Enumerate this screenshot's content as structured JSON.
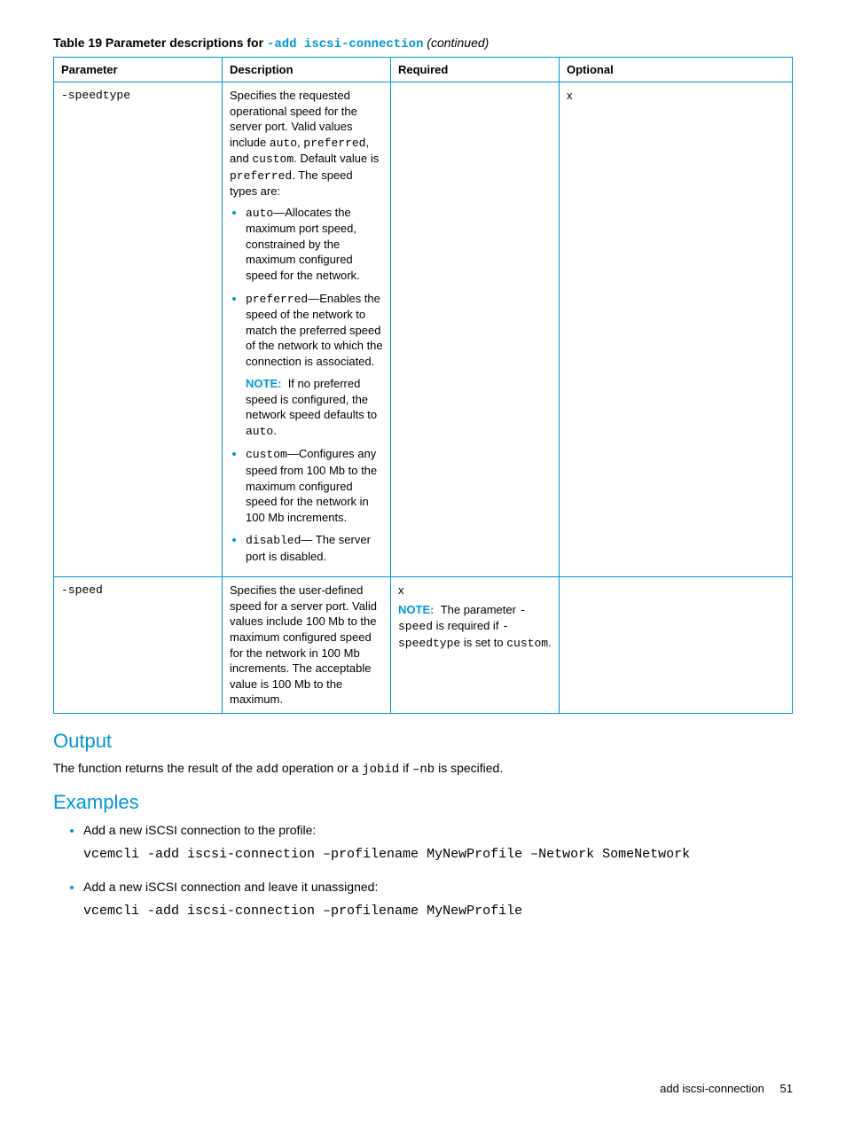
{
  "table": {
    "title_prefix": "Table 19 Parameter descriptions for ",
    "title_code": "-add iscsi-connection",
    "title_suffix": " (continued)",
    "headers": {
      "param": "Parameter",
      "desc": "Description",
      "req": "Required",
      "opt": "Optional"
    },
    "row1": {
      "param": "-speedtype",
      "desc_intro_a": "Specifies the requested operational speed for the server port. Valid values include ",
      "desc_intro_b": "auto",
      "desc_intro_c": ", ",
      "desc_intro_d": "preferred",
      "desc_intro_e": ", and ",
      "desc_intro_f": "custom",
      "desc_intro_g": ". Default value is ",
      "desc_intro_h": "preferred",
      "desc_intro_i": ". The speed types are:",
      "li1_a": "auto",
      "li1_b": "—Allocates the maximum port speed, constrained by the maximum configured speed for the network.",
      "li2_a": "preferred",
      "li2_b": "—Enables the speed of the network to match the preferred speed of the network to which the connection is associated.",
      "note_label": "NOTE:",
      "note_text_a": "If no preferred speed is configured, the network speed defaults to ",
      "note_text_b": "auto",
      "note_text_c": ".",
      "li3_a": "custom",
      "li3_b": "—Configures any speed from 100 Mb to the maximum configured speed for the network in 100 Mb increments.",
      "li4_a": "disabled",
      "li4_b": "— The server port is disabled.",
      "req": "",
      "opt": "x"
    },
    "row2": {
      "param": "-speed",
      "desc": "Specifies the user-defined speed for a server port. Valid values include 100 Mb to the maximum configured speed for the network in 100 Mb increments. The acceptable value is 100 Mb to the maximum.",
      "req_x": "x",
      "note_label": "NOTE:",
      "req_note_a": "The parameter ",
      "req_note_b": "-speed",
      "req_note_c": " is required if ",
      "req_note_d": "-speedtype",
      "req_note_e": " is set to ",
      "req_note_f": "custom",
      "req_note_g": ".",
      "opt": ""
    }
  },
  "output": {
    "heading": "Output",
    "text_a": "The function returns the result of the ",
    "text_b": "add",
    "text_c": " operation or a ",
    "text_d": "jobid",
    "text_e": " if ",
    "text_f": "–nb",
    "text_g": " is specified."
  },
  "examples": {
    "heading": "Examples",
    "item1_text": "Add a new iSCSI connection to the profile:",
    "item1_code": "vcemcli -add iscsi-connection –profilename MyNewProfile –Network SomeNetwork",
    "item2_text": "Add a new iSCSI connection and leave it unassigned:",
    "item2_code": "vcemcli -add iscsi-connection –profilename MyNewProfile"
  },
  "footer": {
    "label": "add iscsi-connection",
    "page": "51"
  }
}
